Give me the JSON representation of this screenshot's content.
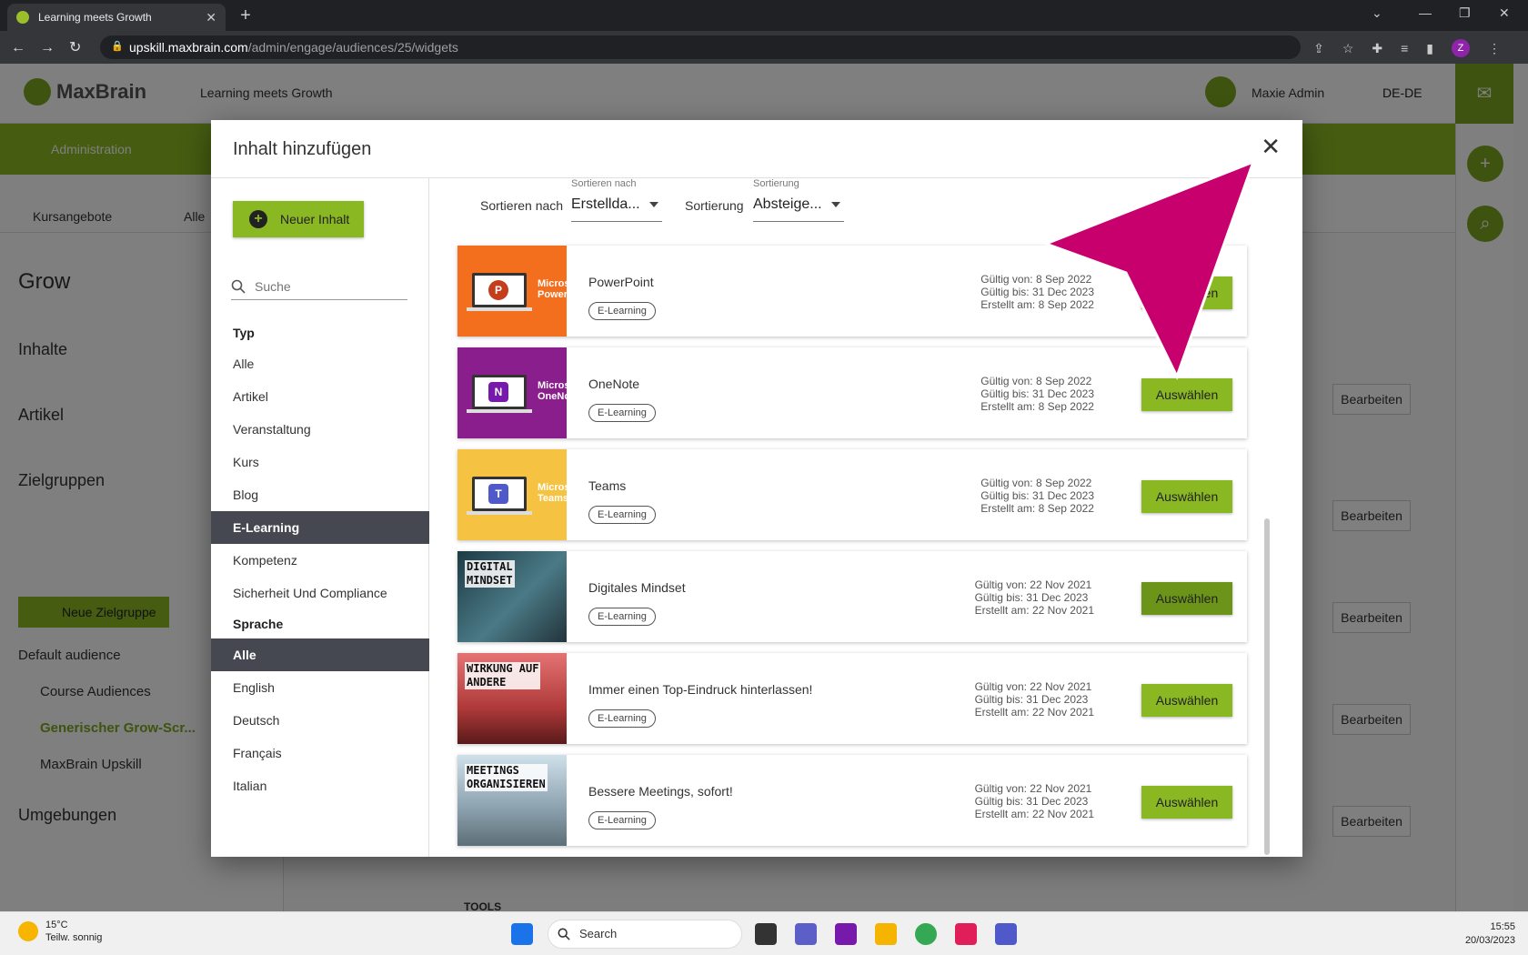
{
  "browser": {
    "tab_title": "Learning meets Growth",
    "url_host": "upskill.maxbrain.com",
    "url_path": "/admin/engage/audiences/25/widgets",
    "profile_initial": "Z"
  },
  "app": {
    "brand": "MaxBrain",
    "tagline": "Learning meets Growth",
    "user_name": "Maxie Admin",
    "language": "DE-DE",
    "nav_admin": "Administration",
    "subnav_courses": "Kursangebote",
    "subnav_all": "Alle",
    "sidebar": {
      "title": "Grow",
      "items": [
        "Inhalte",
        "Artikel",
        "Zielgruppen"
      ],
      "new_group_button": "Neue Zielgruppe",
      "default_audience": "Default audience",
      "sub_items": [
        "Course Audiences",
        "Generischer Grow-Scr...",
        "MaxBrain Upskill"
      ],
      "environments": "Umgebungen"
    },
    "edit_label": "Bearbeiten",
    "bottom_hint": "TOOLS"
  },
  "modal": {
    "title": "Inhalt hinzufügen",
    "new_content_button": "Neuer Inhalt",
    "search_placeholder": "Suche",
    "filter_type_heading": "Typ",
    "type_filters": [
      "Alle",
      "Artikel",
      "Veranstaltung",
      "Kurs",
      "Blog",
      "E-Learning",
      "Kompetenz",
      "Sicherheit Und Compliance"
    ],
    "active_type": "E-Learning",
    "filter_language_heading": "Sprache",
    "language_filters": [
      "Alle",
      "English",
      "Deutsch",
      "Français",
      "Italian"
    ],
    "active_language": "Alle",
    "sort_by_label": "Sortieren nach",
    "sort_by_caption": "Sortieren nach",
    "sort_by_value": "Erstellda...",
    "order_label": "Sortierung",
    "order_caption": "Sortierung",
    "order_value": "Absteige...",
    "select_label": "Auswählen",
    "items": [
      {
        "title": "PowerPoint",
        "tag": "E-Learning",
        "valid_from": "Gültig von: 8 Sep 2022",
        "valid_to": "Gültig bis: 31 Dec 2023",
        "created": "Erstellt am: 8 Sep 2022",
        "thumb_label": "Micros\nPower",
        "icon_letter": "P"
      },
      {
        "title": "OneNote",
        "tag": "E-Learning",
        "valid_from": "Gültig von: 8 Sep 2022",
        "valid_to": "Gültig bis: 31 Dec 2023",
        "created": "Erstellt am: 8 Sep 2022",
        "thumb_label": "Micros\nOneNo",
        "icon_letter": "N"
      },
      {
        "title": "Teams",
        "tag": "E-Learning",
        "valid_from": "Gültig von: 8 Sep 2022",
        "valid_to": "Gültig bis: 31 Dec 2023",
        "created": "Erstellt am: 8 Sep 2022",
        "thumb_label": "Micros\nTeams",
        "icon_letter": "T"
      },
      {
        "title": "Digitales Mindset",
        "tag": "E-Learning",
        "valid_from": "Gültig von: 22 Nov 2021",
        "valid_to": "Gültig bis: 31 Dec 2023",
        "created": "Erstellt am: 22 Nov 2021",
        "thumb_text": "DIGITAL\nMINDSET"
      },
      {
        "title": "Immer einen Top-Eindruck hinterlassen!",
        "tag": "E-Learning",
        "valid_from": "Gültig von: 22 Nov 2021",
        "valid_to": "Gültig bis: 31 Dec 2023",
        "created": "Erstellt am: 22 Nov 2021",
        "thumb_text": "WIRKUNG AUF\nANDERE"
      },
      {
        "title": "Bessere Meetings, sofort!",
        "tag": "E-Learning",
        "valid_from": "Gültig von: 22 Nov 2021",
        "valid_to": "Gültig bis: 31 Dec 2023",
        "created": "Erstellt am: 22 Nov 2021",
        "thumb_text": "MEETINGS\nORGANISIEREN"
      }
    ]
  },
  "taskbar": {
    "temperature": "15°C",
    "weather": "Teilw. sonnig",
    "search": "Search",
    "time": "15:55",
    "date": "20/03/2023"
  },
  "colors": {
    "accent_green": "#8ab822",
    "annotation_arrow": "#c8006e",
    "powerpoint_orange": "#f36f1e",
    "onenote_purple": "#8a1e8c",
    "teams_yellow": "#f5c242"
  }
}
